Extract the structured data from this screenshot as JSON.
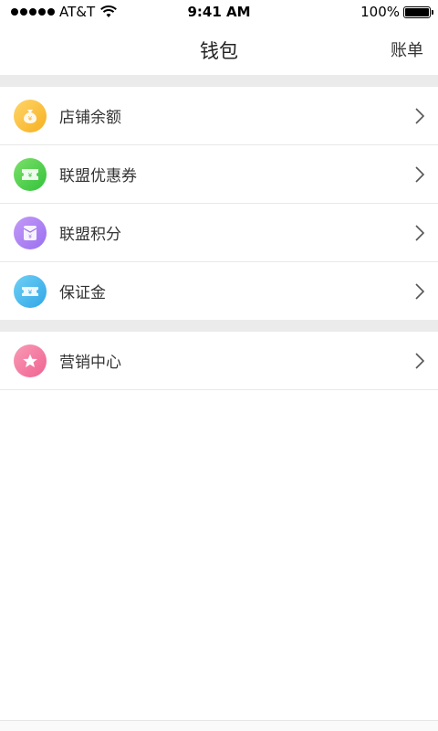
{
  "status_bar": {
    "carrier": "AT&T",
    "time": "9:41 AM",
    "battery": "100%",
    "battery_level": 1.0
  },
  "nav": {
    "title": "钱包",
    "action": "账单"
  },
  "groups": [
    {
      "items": [
        {
          "label": "店铺余额",
          "icon": "money-bag-icon",
          "color_from": "#ffd56a",
          "color_to": "#f6b01f"
        },
        {
          "label": "联盟优惠券",
          "icon": "coupon-icon",
          "color_from": "#7de06a",
          "color_to": "#32c23b"
        },
        {
          "label": "联盟积分",
          "icon": "red-envelope-icon",
          "color_from": "#c39af7",
          "color_to": "#9a6ff0"
        },
        {
          "label": "保证金",
          "icon": "ticket-icon",
          "color_from": "#6fd0f5",
          "color_to": "#2fa6e6"
        }
      ]
    },
    {
      "items": [
        {
          "label": "营销中心",
          "icon": "star-icon",
          "color_from": "#f99ab6",
          "color_to": "#ef6392"
        }
      ]
    }
  ]
}
